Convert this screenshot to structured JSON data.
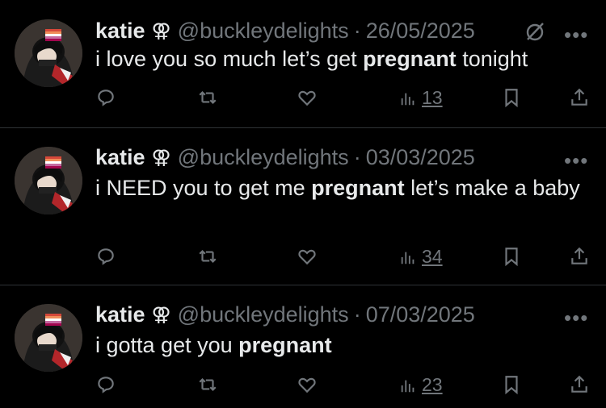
{
  "colors": {
    "background": "#000000",
    "text": "#e7e9ea",
    "muted": "#71767b",
    "separator": "#2f3336"
  },
  "tweets": [
    {
      "name": "katie",
      "symbol": "⚢",
      "handle": "@buckleydelights",
      "separator": "·",
      "date": "26/05/2025",
      "text_before": "i love you so much let’s get ",
      "text_bold": "pregnant",
      "text_after": " tonight",
      "views": "13",
      "has_grok_icon": true,
      "more": "•••"
    },
    {
      "name": "katie",
      "symbol": "⚢",
      "handle": "@buckleydelights",
      "separator": "·",
      "date": "03/03/2025",
      "text_before": "i NEED you to get me ",
      "text_bold": "pregnant",
      "text_after": " let’s make a baby",
      "views": "34",
      "has_grok_icon": false,
      "more": "•••"
    },
    {
      "name": "katie",
      "symbol": "⚢",
      "handle": "@buckleydelights",
      "separator": "·",
      "date": "07/03/2025",
      "text_before": "i gotta get you ",
      "text_bold": "pregnant",
      "text_after": "",
      "views": "23",
      "has_grok_icon": false,
      "more": "•••"
    }
  ],
  "icons": [
    "reply-icon",
    "retweet-icon",
    "like-icon",
    "views-icon",
    "bookmark-icon",
    "share-icon",
    "grok-icon",
    "more-icon"
  ]
}
